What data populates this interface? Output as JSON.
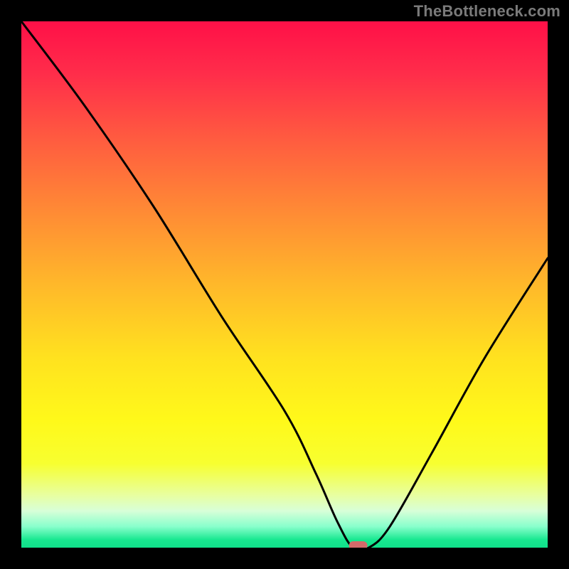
{
  "watermark": "TheBottleneck.com",
  "chart_data": {
    "type": "line",
    "title": "",
    "xlabel": "",
    "ylabel": "",
    "xlim": [
      0,
      100
    ],
    "ylim": [
      0,
      100
    ],
    "grid": false,
    "legend": false,
    "series": [
      {
        "name": "bottleneck-curve",
        "x": [
          0,
          12,
          25,
          38,
          50,
          56,
          60,
          63,
          66,
          70,
          78,
          88,
          100
        ],
        "values": [
          100,
          84,
          65,
          44,
          26,
          14,
          5,
          0,
          0,
          4,
          18,
          36,
          55
        ]
      }
    ],
    "marker": {
      "name": "optimal-point",
      "x": 64,
      "y": 0,
      "color": "#d36a6a"
    },
    "gradient_stops": [
      {
        "pos": 0,
        "color": "#ff1048"
      },
      {
        "pos": 10,
        "color": "#ff2d4a"
      },
      {
        "pos": 22,
        "color": "#ff5a40"
      },
      {
        "pos": 36,
        "color": "#ff8a35"
      },
      {
        "pos": 50,
        "color": "#ffb82a"
      },
      {
        "pos": 64,
        "color": "#ffe21f"
      },
      {
        "pos": 76,
        "color": "#fff91a"
      },
      {
        "pos": 84,
        "color": "#f7ff30"
      },
      {
        "pos": 90,
        "color": "#e8ffa0"
      },
      {
        "pos": 93,
        "color": "#d8ffd8"
      },
      {
        "pos": 96,
        "color": "#88ffcc"
      },
      {
        "pos": 98.5,
        "color": "#18e890"
      },
      {
        "pos": 100,
        "color": "#10e08a"
      }
    ]
  }
}
